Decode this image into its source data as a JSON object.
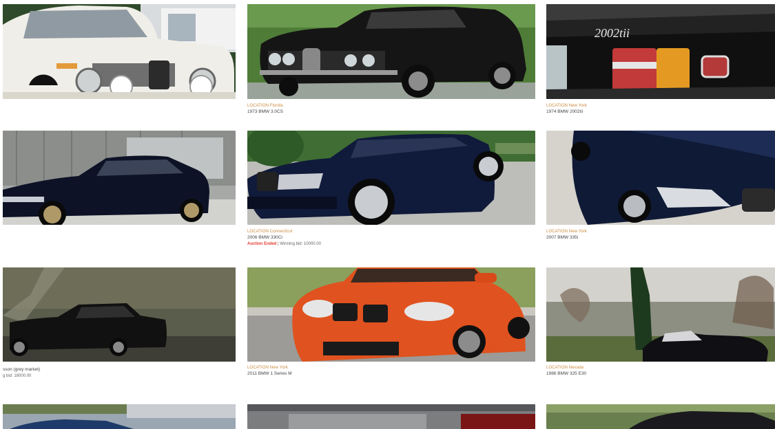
{
  "listings": [
    {
      "id": "r1c1",
      "location": "",
      "title": "",
      "status_ended": "",
      "status_bid": ""
    },
    {
      "id": "r1c2",
      "location": "LOCATION Florida",
      "title": "1973 BMW 3.0CS",
      "status_ended": "",
      "status_bid": ""
    },
    {
      "id": "r1c3",
      "location": "LOCATION New York",
      "title": "1974 BMW 2002tii",
      "status_ended": "",
      "status_bid": ""
    },
    {
      "id": "r2c1",
      "location": "",
      "title": "",
      "status_ended": "",
      "status_bid": ""
    },
    {
      "id": "r2c2",
      "location": "LOCATION Connecticut",
      "title": "2006 BMW 330Ci",
      "status_ended": "Auction Ended",
      "status_bid": " | Winning bid: 10000.00"
    },
    {
      "id": "r2c3",
      "location": "LOCATION New York",
      "title": "2007 BMW 335i",
      "status_ended": "",
      "status_bid": ""
    },
    {
      "id": "r3c1",
      "location": "",
      "title": "sson (grey market)",
      "status_ended": "",
      "status_bid": "g bid: 18000.00"
    },
    {
      "id": "r3c2",
      "location": "LOCATION New York",
      "title": "2011 BMW 1 Series M",
      "status_ended": "",
      "status_bid": ""
    },
    {
      "id": "r3c3",
      "location": "LOCATION Nevada",
      "title": "1986 BMW 325 E30",
      "status_ended": "",
      "status_bid": ""
    }
  ]
}
